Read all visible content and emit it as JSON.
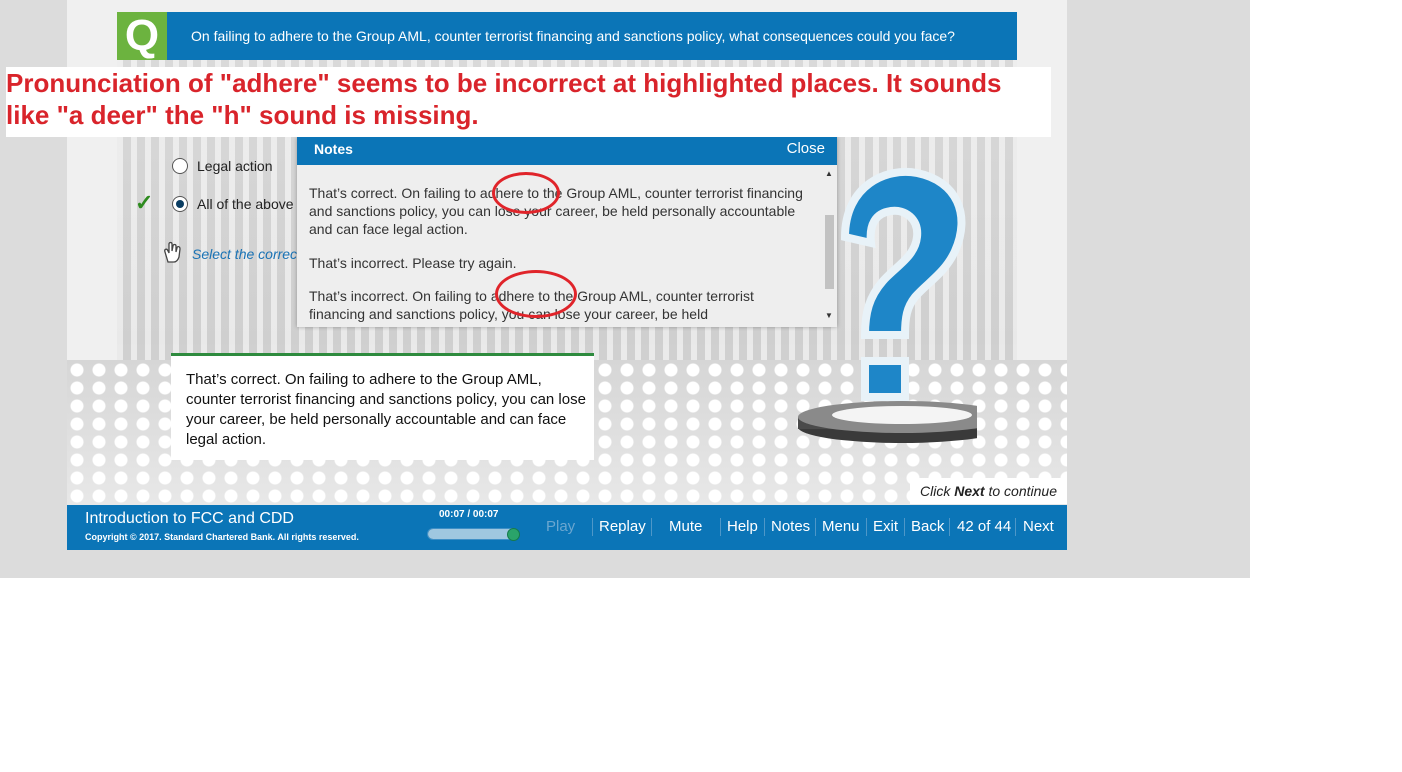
{
  "question": {
    "badge": "Q",
    "text": "On failing to adhere to the Group AML, counter terrorist financing and sanctions policy, what consequences could you face?"
  },
  "options": [
    {
      "label": "Legal action",
      "selected": false
    },
    {
      "label": "All of the above",
      "selected": true
    }
  ],
  "select_hint": "Select the correct",
  "notes": {
    "title": "Notes",
    "close_label": "Close",
    "entries": [
      "That’s correct. On failing to adhere to the Group AML, counter terrorist financing and sanctions policy, you can lose your career, be held personally accountable and can face legal action.",
      "That’s incorrect. Please try again.",
      "That’s incorrect. On failing to adhere to the Group AML, counter terrorist financing and sanctions policy, you can lose your career, be held"
    ]
  },
  "feedback": {
    "text": "That’s correct. On failing to adhere to the Group AML, counter terrorist financing and sanctions policy, you can lose your career, be held personally accountable and can face legal action."
  },
  "continue_prompt": {
    "prefix": "Click ",
    "bold": "Next",
    "suffix": " to continue"
  },
  "footer": {
    "course_title": "Introduction to FCC and CDD",
    "copyright": "Copyright © 2017. Standard Chartered Bank. All rights reserved.",
    "timecode": "00:07 / 00:07",
    "progress": 1.0,
    "nav": {
      "play": "Play",
      "replay": "Replay",
      "mute": "Mute",
      "help": "Help",
      "notes": "Notes",
      "menu": "Menu",
      "exit": "Exit",
      "back": "Back",
      "page_counter": "42 of 44",
      "next": "Next"
    }
  },
  "annotation": {
    "text": "Pronunciation of \"adhere\" seems to be incorrect at highlighted places. It sounds like \"a deer\" the \"h\" sound is missing."
  },
  "colors": {
    "brand_blue": "#0b75b7",
    "badge_green": "#6cb33f",
    "annotation_red": "#d9242b",
    "feedback_border": "#2e8b3e"
  }
}
